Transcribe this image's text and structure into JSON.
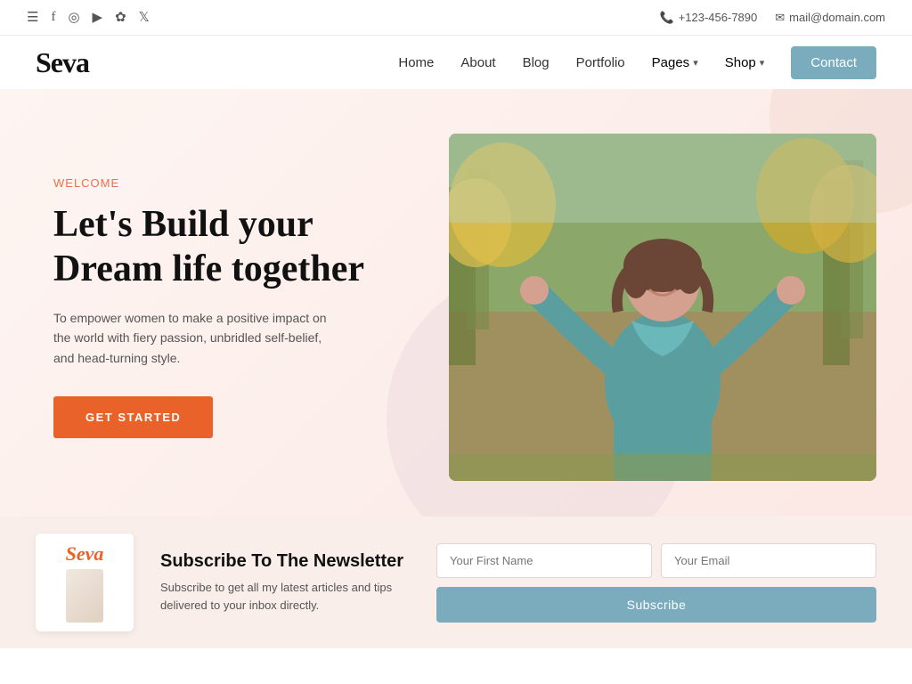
{
  "topbar": {
    "phone": "+123-456-7890",
    "email": "mail@domain.com"
  },
  "nav": {
    "logo": "Seva",
    "links": [
      {
        "label": "Home",
        "name": "home"
      },
      {
        "label": "About",
        "name": "about"
      },
      {
        "label": "Blog",
        "name": "blog"
      },
      {
        "label": "Portfolio",
        "name": "portfolio"
      },
      {
        "label": "Pages",
        "name": "pages",
        "dropdown": true
      },
      {
        "label": "Shop",
        "name": "shop",
        "dropdown": true
      }
    ],
    "contact_label": "Contact"
  },
  "hero": {
    "welcome": "Welcome",
    "title": "Let's Build your Dream life together",
    "description": "To empower women to make a positive impact on the world with fiery passion, unbridled self-belief, and head-turning style.",
    "cta_label": "GET STARTED"
  },
  "newsletter": {
    "logo_text": "Seva",
    "title": "Subscribe To The Newsletter",
    "description": "Subscribe to get all my latest articles and tips delivered to your inbox directly.",
    "first_name_placeholder": "Your First Name",
    "email_placeholder": "Your Email",
    "subscribe_label": "Subscribe"
  }
}
